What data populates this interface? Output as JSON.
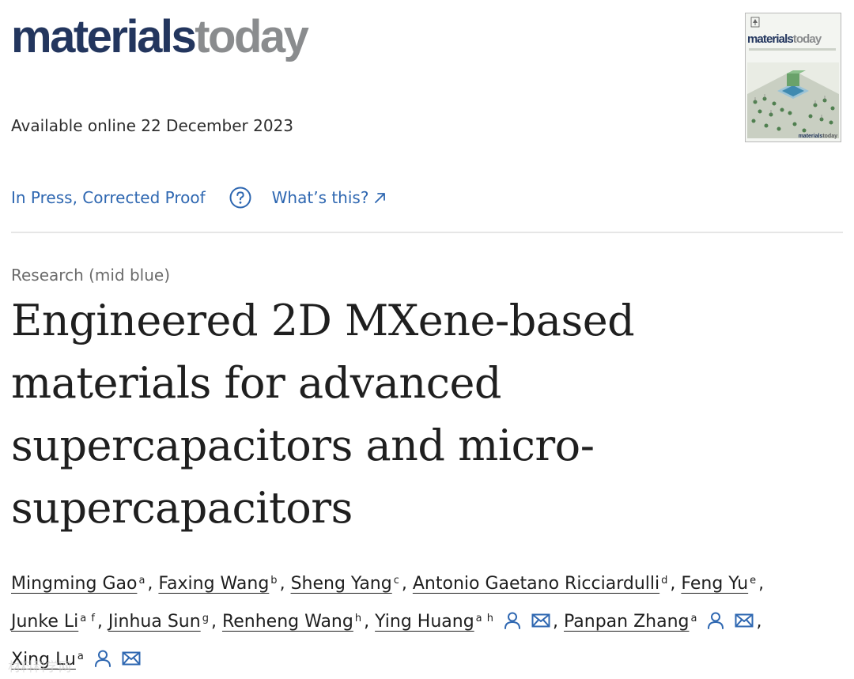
{
  "header": {
    "logo_part1": "materials",
    "logo_part2": "today"
  },
  "cover": {
    "title_part1": "materials",
    "title_part2": "today",
    "brand_part1": "materials",
    "brand_part2": "today"
  },
  "article": {
    "available_online": "Available online 22 December 2023",
    "status": "In Press, Corrected Proof",
    "whats_this": "What’s this?",
    "type": "Research (mid blue)",
    "title": "Engineered 2D MXene-based materials for advanced supercapacitors and micro-supercapacitors"
  },
  "authors": [
    {
      "name": "Mingming Gao",
      "aff": "a"
    },
    {
      "name": "Faxing Wang",
      "aff": "b"
    },
    {
      "name": "Sheng Yang",
      "aff": "c"
    },
    {
      "name": "Antonio Gaetano Ricciardulli",
      "aff": "d"
    },
    {
      "name": "Feng Yu",
      "aff": "e"
    },
    {
      "name": "Junke Li",
      "aff": "a f"
    },
    {
      "name": "Jinhua Sun",
      "aff": "g"
    },
    {
      "name": "Renheng Wang",
      "aff": "h"
    },
    {
      "name": "Ying Huang",
      "aff": "a h"
    },
    {
      "name": "Panpan Zhang",
      "aff": "a"
    },
    {
      "name": "Xing Lu",
      "aff": "a"
    }
  ],
  "watermark": "材料科学网",
  "colors": {
    "link_blue": "#2e67b1",
    "logo_navy": "#23365e",
    "logo_gray": "#8a8c8e",
    "text": "#1f1f1f",
    "muted": "#6b6b6b"
  },
  "icons": {
    "help": "question-circle-icon",
    "external": "arrow-up-right-icon",
    "person": "person-icon",
    "mail": "envelope-icon"
  }
}
